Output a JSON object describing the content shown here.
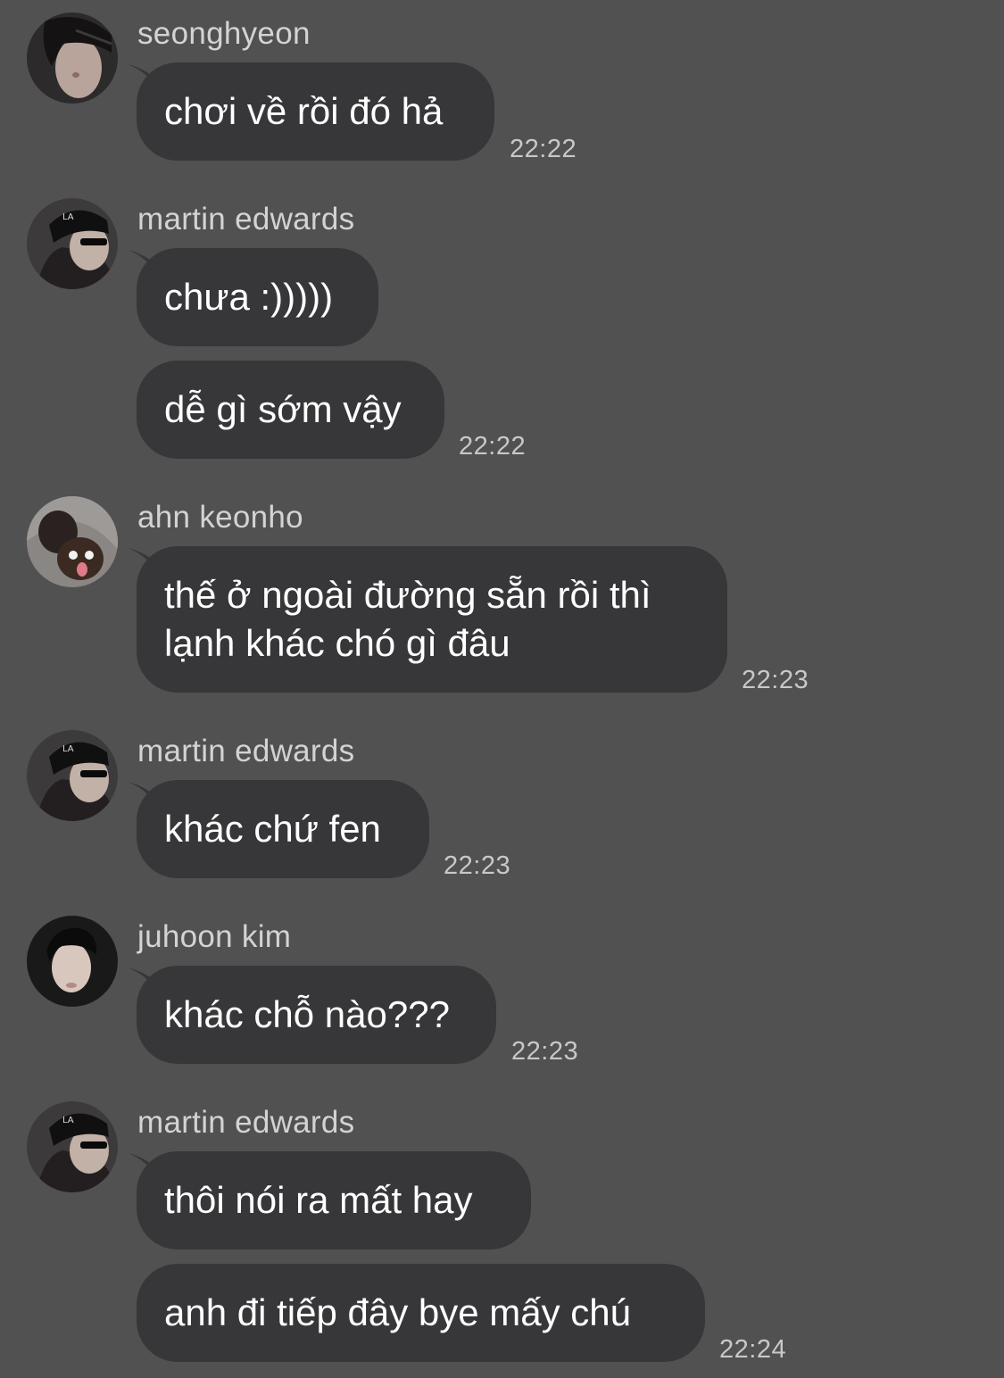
{
  "messages": {
    "g1": {
      "sender": "seonghyeon",
      "avatar": "avatar-seonghyeon-photo",
      "bubbles": [
        "chơi về rồi đó hả"
      ],
      "time": "22:22"
    },
    "g2": {
      "sender": "martin edwards",
      "avatar": "avatar-martin-edwards-photo",
      "bubbles": [
        "chưa :)))))",
        "dễ gì sớm vậy"
      ],
      "time": "22:22"
    },
    "g3": {
      "sender": "ahn keonho",
      "avatar": "avatar-ahn-keonho-photo",
      "bubbles": [
        "thế ở ngoài đường sẵn rồi thì lạnh khác chó gì đâu"
      ],
      "lines": [
        "thế ở ngoài đường sẵn rồi thì",
        "lạnh khác chó gì đâu"
      ],
      "time": "22:23"
    },
    "g4": {
      "sender": "martin edwards",
      "avatar": "avatar-martin-edwards-photo",
      "bubbles": [
        "khác chứ fen"
      ],
      "time": "22:23"
    },
    "g5": {
      "sender": "juhoon kim",
      "avatar": "avatar-juhoon-kim-photo",
      "bubbles": [
        "khác chỗ nào???"
      ],
      "time": "22:23"
    },
    "g6": {
      "sender": "martin edwards",
      "avatar": "avatar-martin-edwards-photo",
      "bubbles": [
        "thôi nói ra mất hay",
        "anh đi tiếp đây bye mấy chú"
      ],
      "time": "22:24"
    }
  },
  "colors": {
    "background": "#525152",
    "bubble": "#373638",
    "message_text": "#ffffff",
    "meta_text": "#d4d3d4"
  }
}
